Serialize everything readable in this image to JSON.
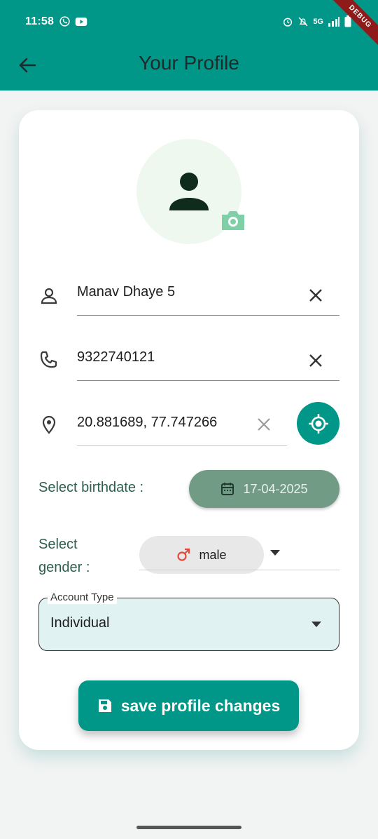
{
  "status_bar": {
    "time": "11:58",
    "network": "5G",
    "debug_banner": "DEBUG"
  },
  "app_bar": {
    "title": "Your Profile",
    "back_icon": "arrow-left-icon"
  },
  "profile": {
    "avatar_icon": "person-icon",
    "camera_icon": "camera-icon",
    "name": "Manav Dhaye 5",
    "phone": "9322740121",
    "location": "20.881689, 77.747266",
    "birthdate_label": "Select birthdate :",
    "birthdate": "17-04-2025",
    "gender_label": "Select gender :",
    "gender": "male",
    "account_type_label": "Account Type",
    "account_type": "Individual",
    "save_label": "save profile changes"
  },
  "colors": {
    "primary": "#009688",
    "date_button": "#719b85",
    "label_green": "#2d5f4f",
    "account_fill": "#e0f2f1",
    "male_icon": "#e5483a"
  }
}
